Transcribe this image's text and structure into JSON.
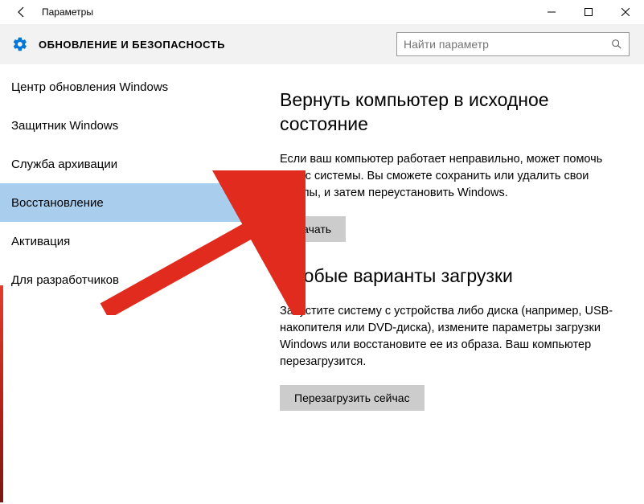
{
  "window": {
    "title": "Параметры"
  },
  "header": {
    "title": "ОБНОВЛЕНИЕ И БЕЗОПАСНОСТЬ",
    "search_placeholder": "Найти параметр"
  },
  "sidebar": {
    "items": [
      {
        "label": "Центр обновления Windows"
      },
      {
        "label": "Защитник Windows"
      },
      {
        "label": "Служба архивации"
      },
      {
        "label": "Восстановление"
      },
      {
        "label": "Активация"
      },
      {
        "label": "Для разработчиков"
      }
    ],
    "selected_index": 3
  },
  "content": {
    "section1": {
      "title": "Вернуть компьютер в исходное состояние",
      "text": "Если ваш компьютер работает неправильно, может помочь сброс системы. Вы сможете сохранить или удалить свои файлы, и затем переустановить Windows.",
      "button": "Начать"
    },
    "section2": {
      "title": "Особые варианты загрузки",
      "text": "Запустите систему с устройства либо диска (например, USB-накопителя или DVD-диска), измените параметры загрузки Windows или восстановите ее из образа. Ваш компьютер перезагрузится.",
      "button": "Перезагрузить сейчас"
    }
  }
}
